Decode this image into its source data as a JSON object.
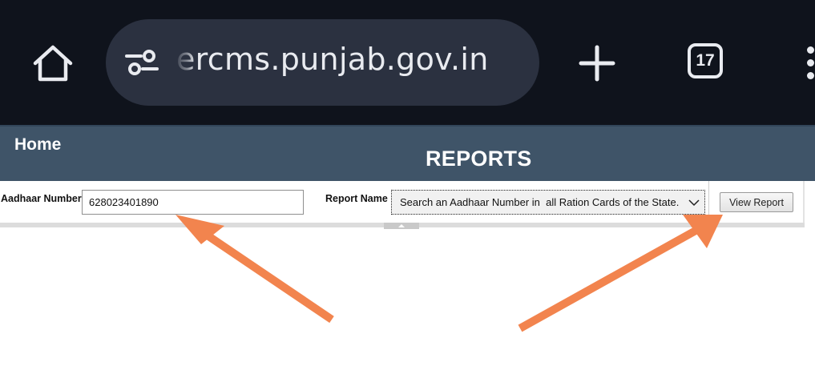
{
  "browser": {
    "url": "ercms.punjab.gov.in",
    "tab_count": "17",
    "icons": [
      "home-icon",
      "site-settings-icon",
      "plus-icon",
      "more-vert-icon"
    ]
  },
  "header": {
    "nav_home": "Home",
    "title": "REPORTS"
  },
  "form": {
    "aadhaar_label": "Aadhaar Number",
    "aadhaar_value": "628023401890",
    "report_label": "Report Name",
    "report_selected": "Search an Aadhaar Number in  all Ration Cards of the State.",
    "view_button": "View Report"
  },
  "colors": {
    "browser_bg": "#0f131c",
    "url_pill": "#2b3140",
    "header_bg": "#3f5468",
    "annotation_arrow": "#f2844e"
  }
}
